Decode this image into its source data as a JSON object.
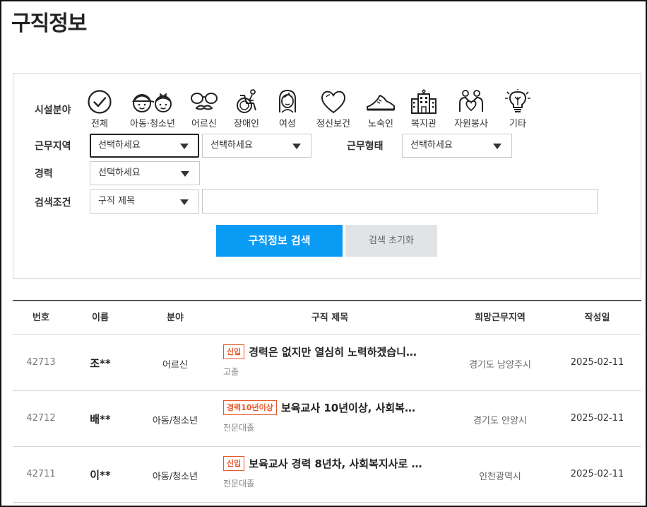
{
  "page_title": "구직정보",
  "search": {
    "facility_label": "시설분야",
    "facilities": [
      {
        "label": "전체",
        "icon": "check-circle-icon"
      },
      {
        "label": "아동·청소년",
        "icon": "children-icon"
      },
      {
        "label": "어르신",
        "icon": "glasses-mustache-icon"
      },
      {
        "label": "장애인",
        "icon": "wheelchair-icon"
      },
      {
        "label": "여성",
        "icon": "woman-icon"
      },
      {
        "label": "정신보건",
        "icon": "heart-icon"
      },
      {
        "label": "노숙인",
        "icon": "shoe-icon"
      },
      {
        "label": "복지관",
        "icon": "building-icon"
      },
      {
        "label": "자원봉사",
        "icon": "volunteer-hands-icon"
      },
      {
        "label": "기타",
        "icon": "lightbulb-icon"
      }
    ],
    "region_label": "근무지역",
    "region_select_1": "선택하세요",
    "region_select_2": "선택하세요",
    "work_type_label": "근무형태",
    "work_type_select": "선택하세요",
    "career_label": "경력",
    "career_select": "선택하세요",
    "condition_label": "검색조건",
    "condition_select": "구직 제목",
    "keyword_value": "",
    "search_button": "구직정보 검색",
    "reset_button": "검색 초기화"
  },
  "table": {
    "headers": {
      "number": "번호",
      "name": "이름",
      "field": "분야",
      "title": "구직 제목",
      "region": "희망근무지역",
      "date": "작성일"
    },
    "rows": [
      {
        "number": "42713",
        "name": "조**",
        "field": "어르신",
        "badge": "신입",
        "title": "경력은 없지만 열심히 노력하겠습니…",
        "education": "고졸",
        "region": "경기도 남양주시",
        "date": "2025-02-11"
      },
      {
        "number": "42712",
        "name": "배**",
        "field": "아동/청소년",
        "badge": "경력10년이상",
        "title": "보육교사 10년이상, 사회복…",
        "education": "전문대졸",
        "region": "경기도 안양시",
        "date": "2025-02-11"
      },
      {
        "number": "42711",
        "name": "이**",
        "field": "아동/청소년",
        "badge": "신입",
        "title": "보육교사 경력 8년차, 사회복지사로 …",
        "education": "전문대졸",
        "region": "인천광역시",
        "date": "2025-02-11"
      }
    ]
  },
  "colors": {
    "primary_button": "#0a9bf5",
    "badge": "#e8572a"
  }
}
